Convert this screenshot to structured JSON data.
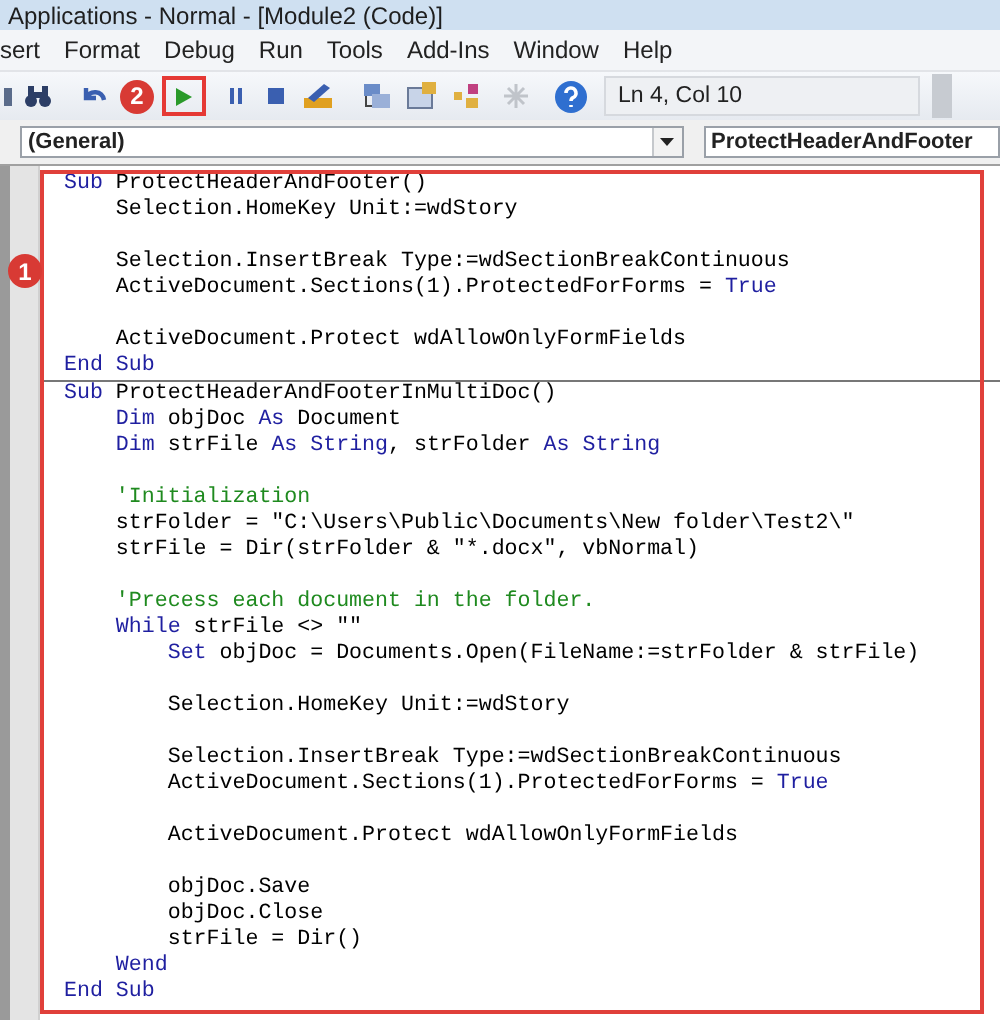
{
  "window": {
    "title": "Applications - Normal - [Module2 (Code)]"
  },
  "menu": [
    "sert",
    "Format",
    "Debug",
    "Run",
    "Tools",
    "Add-Ins",
    "Window",
    "Help"
  ],
  "toolbar": {
    "position": "Ln 4, Col 10",
    "callout": "2"
  },
  "object_combo": {
    "value": "(General)"
  },
  "procedure_combo": {
    "value": "ProtectHeaderAndFooter"
  },
  "code_callout": "1",
  "code_lines": [
    {
      "kind": "code",
      "segments": [
        {
          "kind": "keyword",
          "text": "Sub"
        },
        {
          "kind": "plain",
          "text": " ProtectHeaderAndFooter()"
        }
      ]
    },
    {
      "kind": "code",
      "segments": [
        {
          "kind": "plain",
          "text": "    Selection.HomeKey Unit:=wdStory"
        }
      ]
    },
    {
      "kind": "blank"
    },
    {
      "kind": "code",
      "segments": [
        {
          "kind": "plain",
          "text": "    Selection.InsertBreak Type:=wdSectionBreakContinuous"
        }
      ]
    },
    {
      "kind": "code",
      "segments": [
        {
          "kind": "plain",
          "text": "    ActiveDocument.Sections(1).ProtectedForForms = "
        },
        {
          "kind": "keyword",
          "text": "True"
        }
      ]
    },
    {
      "kind": "blank"
    },
    {
      "kind": "code",
      "segments": [
        {
          "kind": "plain",
          "text": "    ActiveDocument.Protect wdAllowOnlyFormFields"
        }
      ]
    },
    {
      "kind": "code",
      "segments": [
        {
          "kind": "keyword",
          "text": "End Sub"
        }
      ]
    },
    {
      "kind": "separator"
    },
    {
      "kind": "code",
      "segments": [
        {
          "kind": "keyword",
          "text": "Sub"
        },
        {
          "kind": "plain",
          "text": " ProtectHeaderAndFooterInMultiDoc()"
        }
      ]
    },
    {
      "kind": "code",
      "segments": [
        {
          "kind": "keyword",
          "text": "    Dim"
        },
        {
          "kind": "plain",
          "text": " objDoc "
        },
        {
          "kind": "keyword",
          "text": "As"
        },
        {
          "kind": "plain",
          "text": " Document"
        }
      ]
    },
    {
      "kind": "code",
      "segments": [
        {
          "kind": "keyword",
          "text": "    Dim"
        },
        {
          "kind": "plain",
          "text": " strFile "
        },
        {
          "kind": "keyword",
          "text": "As String"
        },
        {
          "kind": "plain",
          "text": ", strFolder "
        },
        {
          "kind": "keyword",
          "text": "As String"
        }
      ]
    },
    {
      "kind": "blank"
    },
    {
      "kind": "code",
      "segments": [
        {
          "kind": "comment",
          "text": "    'Initialization"
        }
      ]
    },
    {
      "kind": "code",
      "segments": [
        {
          "kind": "plain",
          "text": "    strFolder = \"C:\\Users\\Public\\Documents\\New folder\\Test2\\\""
        }
      ]
    },
    {
      "kind": "code",
      "segments": [
        {
          "kind": "plain",
          "text": "    strFile = Dir(strFolder & \"*.docx\", vbNormal)"
        }
      ]
    },
    {
      "kind": "blank"
    },
    {
      "kind": "code",
      "segments": [
        {
          "kind": "comment",
          "text": "    'Precess each document in the folder."
        }
      ]
    },
    {
      "kind": "code",
      "segments": [
        {
          "kind": "keyword",
          "text": "    While"
        },
        {
          "kind": "plain",
          "text": " strFile <> \"\""
        }
      ]
    },
    {
      "kind": "code",
      "segments": [
        {
          "kind": "keyword",
          "text": "        Set"
        },
        {
          "kind": "plain",
          "text": " objDoc = Documents.Open(FileName:=strFolder & strFile)"
        }
      ]
    },
    {
      "kind": "blank"
    },
    {
      "kind": "code",
      "segments": [
        {
          "kind": "plain",
          "text": "        Selection.HomeKey Unit:=wdStory"
        }
      ]
    },
    {
      "kind": "blank"
    },
    {
      "kind": "code",
      "segments": [
        {
          "kind": "plain",
          "text": "        Selection.InsertBreak Type:=wdSectionBreakContinuous"
        }
      ]
    },
    {
      "kind": "code",
      "segments": [
        {
          "kind": "plain",
          "text": "        ActiveDocument.Sections(1).ProtectedForForms = "
        },
        {
          "kind": "keyword",
          "text": "True"
        }
      ]
    },
    {
      "kind": "blank"
    },
    {
      "kind": "code",
      "segments": [
        {
          "kind": "plain",
          "text": "        ActiveDocument.Protect wdAllowOnlyFormFields"
        }
      ]
    },
    {
      "kind": "blank"
    },
    {
      "kind": "code",
      "segments": [
        {
          "kind": "plain",
          "text": "        objDoc.Save"
        }
      ]
    },
    {
      "kind": "code",
      "segments": [
        {
          "kind": "plain",
          "text": "        objDoc.Close"
        }
      ]
    },
    {
      "kind": "code",
      "segments": [
        {
          "kind": "plain",
          "text": "        strFile = Dir()"
        }
      ]
    },
    {
      "kind": "code",
      "segments": [
        {
          "kind": "keyword",
          "text": "    Wend"
        }
      ]
    },
    {
      "kind": "code",
      "segments": [
        {
          "kind": "keyword",
          "text": "End Sub"
        }
      ]
    }
  ]
}
